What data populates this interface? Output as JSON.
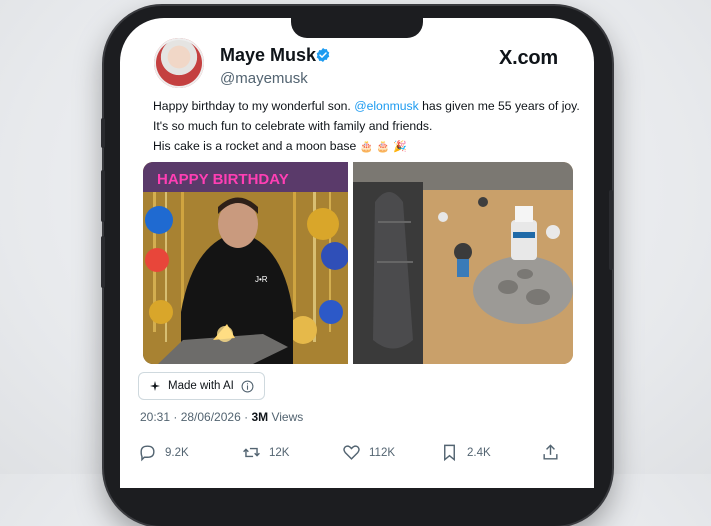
{
  "tweet": {
    "author_name": "Maye Musk",
    "author_handle": "@mayemusk",
    "site_label": "X.com",
    "text_part1": "Happy birthday to my wonderful son.",
    "mention": "@elonmusk",
    "text_part2": "has given me 55 years of joy.",
    "line2": "It's so much fun to celebrate with family and friends.",
    "line3": "His cake is a rocket and a moon base",
    "line3_emojis": "🎂 🎂 🎉",
    "banner_text": "HAPPY BIRTHDAY",
    "shirt_text": "J•R",
    "made_with_ai": "Made with AI",
    "timestamp": "20:31 · 28/06/2026 ·",
    "views_count": "3M",
    "views_label": "Views",
    "replies": "9.2K",
    "reposts": "12K",
    "likes": "112K",
    "bookmarks": "2.4K"
  },
  "colors": {
    "verified": "#1d9bf0",
    "mention": "#1d9bf0",
    "text": "#0f1419",
    "secondary": "#536471"
  }
}
